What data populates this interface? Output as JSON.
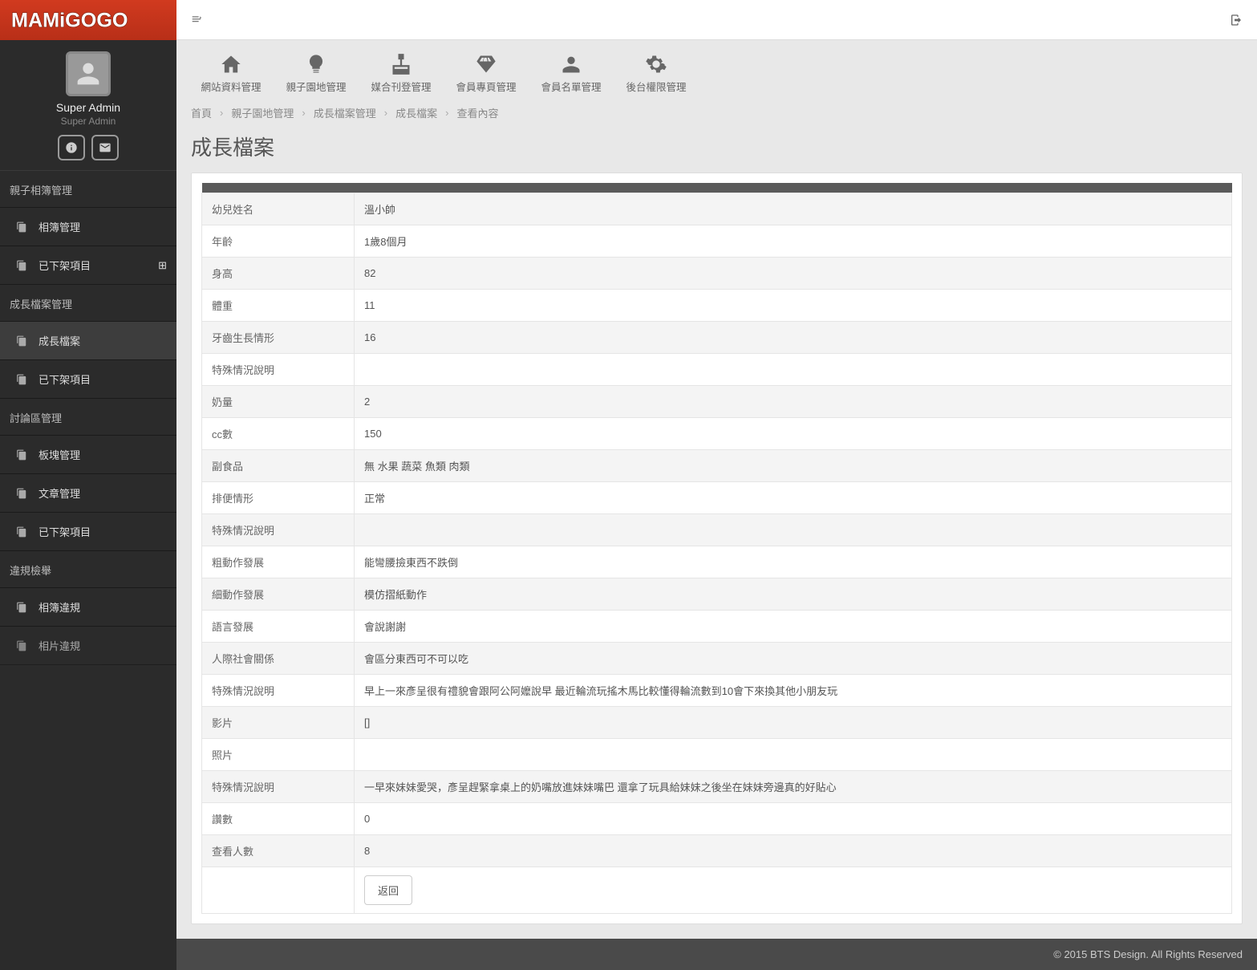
{
  "profile": {
    "name": "Super Admin",
    "role": "Super Admin"
  },
  "nav": {
    "section1": "親子相簿管理",
    "item1": "相簿管理",
    "item2": "已下架項目",
    "section2": "成長檔案管理",
    "item3": "成長檔案",
    "item4": "已下架項目",
    "section3": "討論區管理",
    "item5": "板塊管理",
    "item6": "文章管理",
    "item7": "已下架項目",
    "section4": "違規檢舉",
    "item8": "相簿違規",
    "item9": "相片違規"
  },
  "shortcuts": [
    {
      "label": "網站資料管理"
    },
    {
      "label": "親子園地管理"
    },
    {
      "label": "媒合刊登管理"
    },
    {
      "label": "會員專頁管理"
    },
    {
      "label": "會員名單管理"
    },
    {
      "label": "後台權限管理"
    }
  ],
  "breadcrumb": {
    "b1": "首頁",
    "b2": "親子園地管理",
    "b3": "成長檔案管理",
    "b4": "成長檔案",
    "b5": "查看內容"
  },
  "page_title": "成長檔案",
  "rows": [
    {
      "label": "幼兒姓名",
      "value": "溫小帥"
    },
    {
      "label": "年齡",
      "value": "1歲8個月"
    },
    {
      "label": "身高",
      "value": "82"
    },
    {
      "label": "體重",
      "value": "11"
    },
    {
      "label": "牙齒生長情形",
      "value": "16"
    },
    {
      "label": "特殊情況說明",
      "value": ""
    },
    {
      "label": "奶量",
      "value": "2"
    },
    {
      "label": "cc數",
      "value": "150"
    },
    {
      "label": "副食品",
      "value": "無 水果 蔬菜 魚類 肉類"
    },
    {
      "label": "排便情形",
      "value": "正常"
    },
    {
      "label": "特殊情況說明",
      "value": ""
    },
    {
      "label": "粗動作發展",
      "value": "能彎腰撿東西不跌倒"
    },
    {
      "label": "細動作發展",
      "value": "模仿摺紙動作"
    },
    {
      "label": "語言發展",
      "value": "會說謝謝"
    },
    {
      "label": "人際社會關係",
      "value": "會區分東西可不可以吃"
    },
    {
      "label": "特殊情況說明",
      "value": "早上一來彥呈很有禮貌會跟阿公阿嬤說早 最近輪流玩搖木馬比較懂得輪流數到10會下來換其他小朋友玩"
    },
    {
      "label": "影片",
      "value": "[]"
    },
    {
      "label": "照片",
      "value": ""
    },
    {
      "label": "特殊情況說明",
      "value": "一早來妹妹愛哭，彥呈趕緊拿桌上的奶嘴放進妹妹嘴巴 還拿了玩具給妹妹之後坐在妹妹旁邊真的好貼心"
    },
    {
      "label": "讚數",
      "value": "0"
    },
    {
      "label": "查看人數",
      "value": "8"
    }
  ],
  "back_label": "返回",
  "footer": "© 2015 BTS Design. All Rights Reserved"
}
